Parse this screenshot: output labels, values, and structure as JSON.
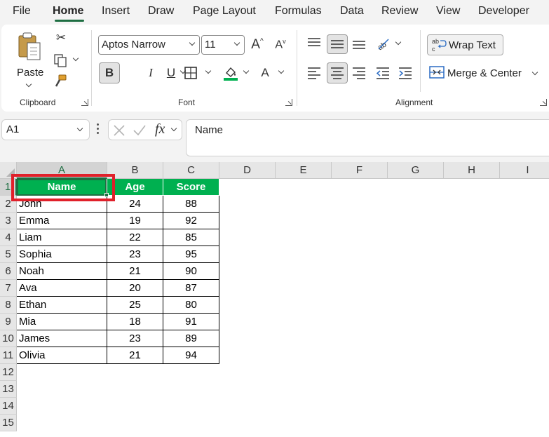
{
  "menu": {
    "tabs": [
      {
        "label": "File",
        "name": "tab-file"
      },
      {
        "label": "Home",
        "name": "tab-home"
      },
      {
        "label": "Insert",
        "name": "tab-insert"
      },
      {
        "label": "Draw",
        "name": "tab-draw"
      },
      {
        "label": "Page Layout",
        "name": "tab-page-layout"
      },
      {
        "label": "Formulas",
        "name": "tab-formulas"
      },
      {
        "label": "Data",
        "name": "tab-data"
      },
      {
        "label": "Review",
        "name": "tab-review"
      },
      {
        "label": "View",
        "name": "tab-view"
      },
      {
        "label": "Developer",
        "name": "tab-developer"
      }
    ],
    "active_tab": "Home"
  },
  "ribbon": {
    "clipboard": {
      "paste_label": "Paste",
      "group_label": "Clipboard"
    },
    "font": {
      "font_name": "Aptos Narrow",
      "font_size": "11",
      "group_label": "Font",
      "bold_glyph": "B",
      "italic_glyph": "I",
      "underline_glyph": "U",
      "font_color_glyph": "A"
    },
    "alignment": {
      "wrap_text_label": "Wrap Text",
      "merge_center_label": "Merge & Center",
      "group_label": "Alignment"
    },
    "accent_color": "#00b050",
    "theme_color": "#1e6e42"
  },
  "formula_bar": {
    "name_box": "A1",
    "fx_label": "fx",
    "content": "Name"
  },
  "sheet": {
    "columns": [
      "A",
      "B",
      "C",
      "D",
      "E",
      "F",
      "G",
      "H",
      "I"
    ],
    "rows": [
      "1",
      "2",
      "3",
      "4",
      "5",
      "6",
      "7",
      "8",
      "9",
      "10",
      "11",
      "12",
      "13",
      "14",
      "15"
    ],
    "selected_cell": "A1",
    "table": {
      "headers": [
        "Name",
        "Age",
        "Score"
      ],
      "rows": [
        [
          "John",
          "24",
          "88"
        ],
        [
          "Emma",
          "19",
          "92"
        ],
        [
          "Liam",
          "22",
          "85"
        ],
        [
          "Sophia",
          "23",
          "95"
        ],
        [
          "Noah",
          "21",
          "90"
        ],
        [
          "Ava",
          "20",
          "87"
        ],
        [
          "Ethan",
          "25",
          "80"
        ],
        [
          "Mia",
          "18",
          "91"
        ],
        [
          "James",
          "23",
          "89"
        ],
        [
          "Olivia",
          "21",
          "94"
        ]
      ]
    },
    "header_fill_color": "#00b050",
    "highlight_color": "#e0202a"
  }
}
